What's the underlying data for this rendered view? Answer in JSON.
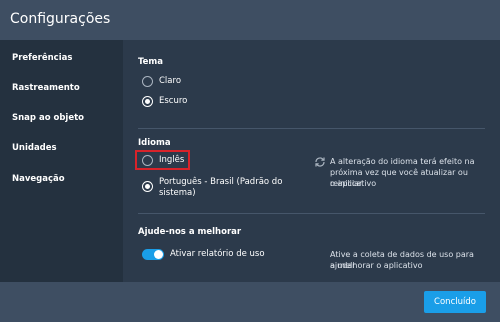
{
  "window": {
    "title": "Configurações"
  },
  "sidebar": {
    "items": [
      {
        "label": "Preferências",
        "active": true
      },
      {
        "label": "Rastreamento"
      },
      {
        "label": "Snap ao objeto"
      },
      {
        "label": "Unidades"
      },
      {
        "label": "Navegação"
      }
    ]
  },
  "theme": {
    "title": "Tema",
    "options": [
      {
        "label": "Claro",
        "checked": false
      },
      {
        "label": "Escuro",
        "checked": true
      }
    ]
  },
  "language": {
    "title": "Idioma",
    "options": [
      {
        "label": "Inglês",
        "checked": false
      },
      {
        "label_line1": "Português - Brasil (Padrão do",
        "label_line2": "sistema)",
        "checked": true
      }
    ],
    "note_line1": "A alteração do idioma terá efeito na",
    "note_line2": "próxima vez que você atualizar ou reiniciar",
    "note_line3": "o aplicativo",
    "note_icon": "sync-icon"
  },
  "usage": {
    "title": "Ajude-nos a melhorar",
    "toggle_label": "Ativar relatório de uso",
    "toggle_on": true,
    "note_line1": "Ative a coleta de dados de uso para ajudar",
    "note_line2": "a melhorar o aplicativo"
  },
  "footer": {
    "done_label": "Concluído"
  },
  "colors": {
    "accent": "#1a9ee8",
    "highlight": "#d8232a",
    "sidebar_bg": "#24313f",
    "content_bg": "#2c3a4b",
    "chrome_bg": "#3e4e62"
  }
}
